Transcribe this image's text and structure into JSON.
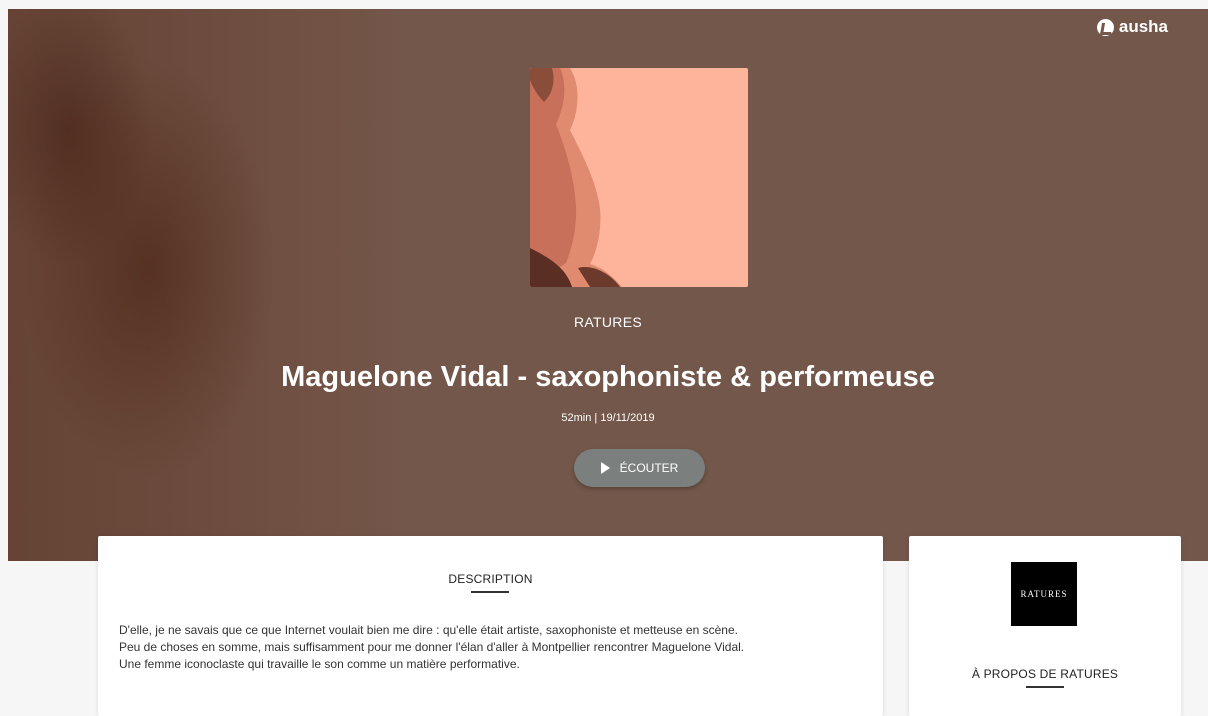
{
  "brand": {
    "name": "ausha"
  },
  "hero": {
    "show_name": "RATURES",
    "episode_title": "Maguelone Vidal - saxophoniste & performeuse",
    "meta": "52min | 19/11/2019",
    "listen_label": "ÉCOUTER"
  },
  "description": {
    "heading": "DESCRIPTION",
    "lines": [
      "D'elle, je ne savais que ce que Internet voulait bien me dire : qu'elle était artiste, saxophoniste et metteuse en scène.",
      "Peu de  choses en somme, mais suffisamment pour me donner l'élan d'aller à  Montpellier rencontrer Maguelone Vidal.",
      "Une femme iconoclaste qui travaille le son comme un matière performative."
    ]
  },
  "about": {
    "logo_text": "RATURES",
    "heading": "À PROPOS DE RATURES"
  },
  "colors": {
    "hero_bg": "#73574a",
    "cover_bg": "#fdb49b",
    "button_bg": "#7b7f7e"
  },
  "icons": [
    "ausha-logo-icon",
    "play-icon"
  ]
}
